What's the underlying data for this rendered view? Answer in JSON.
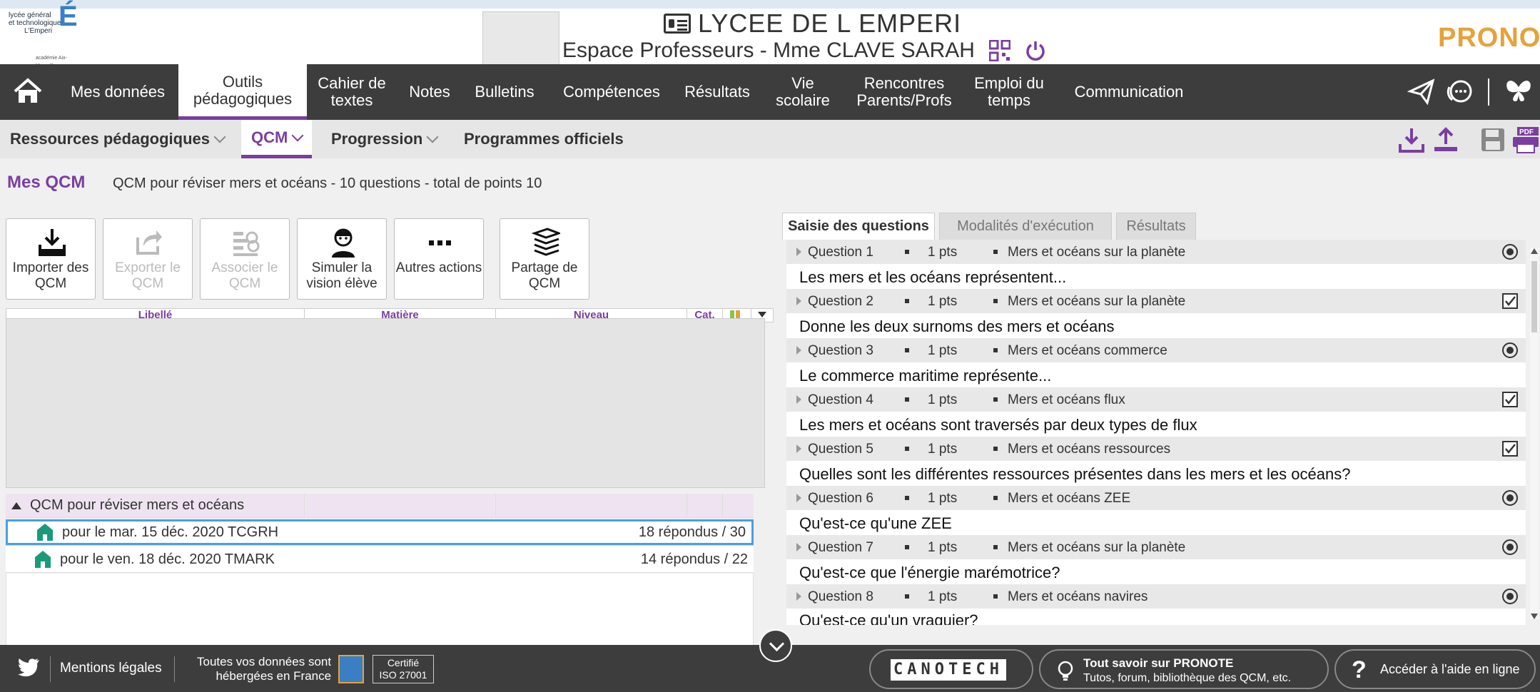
{
  "header": {
    "logo_lines": [
      "lycée général",
      "et technologique",
      "L'Emperi"
    ],
    "logo_sub": "académie Aix-Marseille",
    "school": "LYCEE DE L EMPERI",
    "space": "Espace Professeurs - Mme CLAVE SARAH",
    "brand_a": "PRONOT",
    "brand_b": "E"
  },
  "mainnav": {
    "items": [
      {
        "label": "Mes données"
      },
      {
        "label": "Outils pédagogiques",
        "active": true
      },
      {
        "label": "Cahier de textes"
      },
      {
        "label": "Notes"
      },
      {
        "label": "Bulletins"
      },
      {
        "label": "Compétences"
      },
      {
        "label": "Résultats"
      },
      {
        "label": "Vie scolaire"
      },
      {
        "label": "Rencontres Parents/Profs"
      },
      {
        "label": "Emploi du temps"
      },
      {
        "label": "Communication"
      }
    ]
  },
  "subnav": {
    "items": [
      {
        "label": "Ressources pédagogiques"
      },
      {
        "label": "QCM"
      },
      {
        "label": "Progression"
      },
      {
        "label": "Programmes officiels"
      }
    ],
    "pdf_label": "PDF"
  },
  "breadcrumb": {
    "title": "Mes QCM",
    "desc": "QCM pour réviser mers et océans - 10 questions - total de points 10"
  },
  "toolbar": {
    "buttons": [
      {
        "label": "Importer des QCM",
        "enabled": true
      },
      {
        "label": "Exporter le QCM",
        "enabled": false
      },
      {
        "label": "Associer le QCM",
        "enabled": false
      },
      {
        "label": "Simuler la vision élève",
        "enabled": true
      },
      {
        "label": "Autres actions",
        "enabled": true
      },
      {
        "label": "Partage de QCM",
        "enabled": true
      }
    ]
  },
  "grid": {
    "columns": [
      "Libellé",
      "Matière",
      "Niveau",
      "Cat."
    ],
    "group_label": "QCM pour réviser mers et océans",
    "rows": [
      {
        "text": "pour le mar. 15 déc. 2020  TCGRH",
        "count": "18 répondus / 30",
        "selected": true
      },
      {
        "text": "pour le ven. 18 déc. 2020  TMARK",
        "count": "14 répondus / 22",
        "selected": false
      }
    ]
  },
  "tabs": [
    {
      "label": "Saisie des questions",
      "active": true
    },
    {
      "label": "Modalités d'exécution",
      "active": false
    },
    {
      "label": "Résultats",
      "active": false
    }
  ],
  "questions": [
    {
      "num": "Question 1",
      "pts": "1 pts",
      "topic": "Mers et océans sur la planète",
      "text": "Les mers et les océans représentent...",
      "type": "radio"
    },
    {
      "num": "Question 2",
      "pts": "1 pts",
      "topic": "Mers et océans sur la planète",
      "text": "Donne les deux surnoms des mers et océans",
      "type": "checkbox"
    },
    {
      "num": "Question 3",
      "pts": "1 pts",
      "topic": "Mers et océans commerce",
      "text": "Le commerce maritime représente...",
      "type": "radio"
    },
    {
      "num": "Question 4",
      "pts": "1 pts",
      "topic": "Mers et océans flux",
      "text": "Les mers et océans sont traversés par deux types de flux",
      "type": "checkbox"
    },
    {
      "num": "Question 5",
      "pts": "1 pts",
      "topic": "Mers et océans ressources",
      "text": "Quelles sont les différentes ressources présentes dans les mers et les océans?",
      "type": "checkbox"
    },
    {
      "num": "Question 6",
      "pts": "1 pts",
      "topic": "Mers et océans ZEE",
      "text": "Qu'est-ce qu'une ZEE",
      "type": "radio"
    },
    {
      "num": "Question 7",
      "pts": "1 pts",
      "topic": "Mers et océans sur la planète",
      "text": "Qu'est-ce que l'énergie marémotrice?",
      "type": "radio"
    },
    {
      "num": "Question 8",
      "pts": "1 pts",
      "topic": "Mers et océans navires",
      "text": "Qu'est-ce qu'un vraquier?",
      "type": "radio"
    }
  ],
  "footer": {
    "legal": "Mentions légales",
    "hosted_1": "Toutes vos données sont",
    "hosted_2": "hébergées en France",
    "iso_1": "Certifié",
    "iso_2": "ISO 27001",
    "canotech": "CANOTECH",
    "about_title": "Tout savoir sur PRONOTE",
    "about_sub": "Tutos, forum, bibliothèque des QCM, etc.",
    "help": "Accéder à l'aide en ligne"
  },
  "colors": {
    "accent": "#7a3ea0",
    "nav_bg": "#3d3d3d",
    "group_bg": "#efe3f1",
    "selected_border": "#4a9fe0"
  }
}
